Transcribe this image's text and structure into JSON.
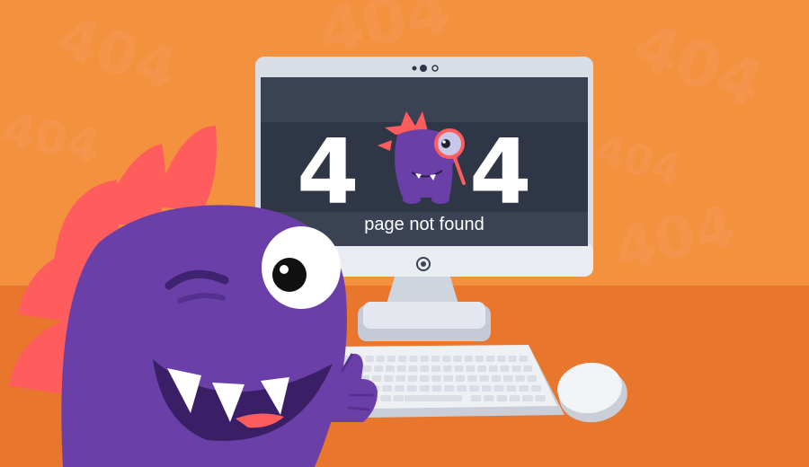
{
  "screen": {
    "digit_left": "4",
    "digit_right": "4",
    "message": "page not found"
  },
  "background": {
    "watermark_text": "404"
  },
  "colors": {
    "background_orange": "#f28a3c",
    "desk_orange": "#e8762d",
    "monster_purple": "#6a40a8",
    "spikes_red": "#ff5d5d",
    "screen_dark": "#2f3646",
    "monitor_bezel": "#d8dde6"
  },
  "icons": {
    "magnifier": "magnifying-glass-icon",
    "camera": "webcam-icon",
    "power": "power-button-icon"
  }
}
